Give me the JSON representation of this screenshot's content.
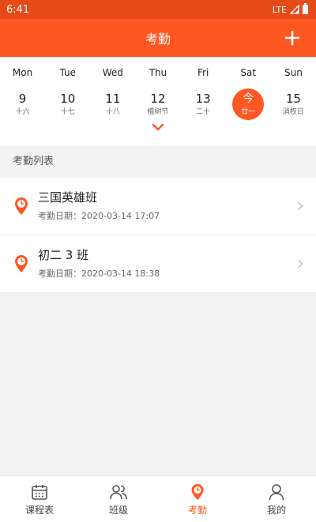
{
  "status_bar": {
    "time": "6:41",
    "network": "LTE"
  },
  "app_bar": {
    "title": "考勤"
  },
  "calendar": {
    "weekdays": [
      "Mon",
      "Tue",
      "Wed",
      "Thu",
      "Fri",
      "Sat",
      "Sun"
    ],
    "days": [
      {
        "num": "9",
        "lunar": "十六"
      },
      {
        "num": "10",
        "lunar": "十七"
      },
      {
        "num": "11",
        "lunar": "十八"
      },
      {
        "num": "12",
        "lunar": "植树节"
      },
      {
        "num": "13",
        "lunar": "二十"
      },
      {
        "num": "今",
        "lunar": "廿一",
        "today": true
      },
      {
        "num": "15",
        "lunar": "消权日"
      }
    ]
  },
  "section": {
    "title": "考勤列表"
  },
  "attendance": [
    {
      "name": "三国英雄班",
      "date_label": "考勤日期：",
      "date": "2020-03-14 17:07"
    },
    {
      "name": "初二 3 班",
      "date_label": "考勤日期：",
      "date": "2020-03-14 18:38"
    }
  ],
  "bottom_nav": [
    {
      "label": "课程表",
      "icon": "calendar-icon"
    },
    {
      "label": "班级",
      "icon": "people-icon"
    },
    {
      "label": "考勤",
      "icon": "location-clock-icon",
      "active": true
    },
    {
      "label": "我的",
      "icon": "person-icon"
    }
  ],
  "colors": {
    "primary": "#ff5722",
    "status_bar": "#e64a19"
  }
}
